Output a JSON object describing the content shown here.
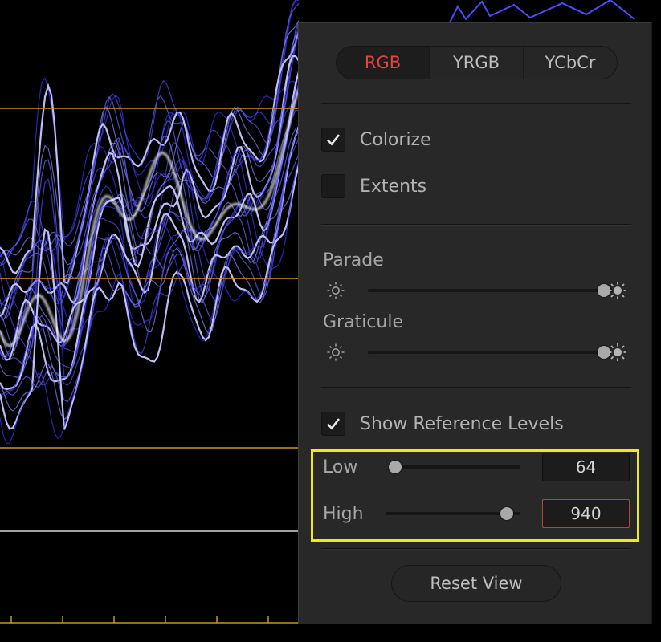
{
  "colors": {
    "accent_red": "#e0463c",
    "reference_line": "#c8942a",
    "waveform": "#4f4cff",
    "highlight": "#ecea1f"
  },
  "mode_tabs": [
    {
      "label": "RGB",
      "selected": true
    },
    {
      "label": "YRGB",
      "selected": false
    },
    {
      "label": "YCbCr",
      "selected": false
    }
  ],
  "options": {
    "colorize": {
      "label": "Colorize",
      "checked": true
    },
    "extents": {
      "label": "Extents",
      "checked": false
    }
  },
  "parade": {
    "label": "Parade",
    "icon_left": "sun-dim-icon",
    "icon_right": "sun-bright-icon",
    "level": 1.0
  },
  "graticule": {
    "label": "Graticule",
    "icon_left": "sun-dim-icon",
    "icon_right": "sun-bright-icon",
    "level": 1.0
  },
  "reference_levels": {
    "show": {
      "label": "Show Reference Levels",
      "checked": true
    },
    "low": {
      "label": "Low",
      "value": "64"
    },
    "high": {
      "label": "High",
      "value": "940"
    }
  },
  "reset_label": "Reset View"
}
